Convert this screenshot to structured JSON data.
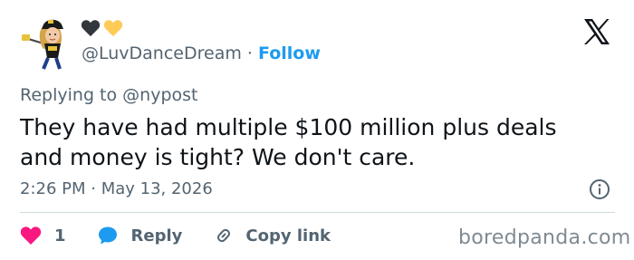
{
  "author": {
    "handle": "@LuvDanceDream",
    "separator": "·",
    "follow_label": "Follow",
    "display_name_emoji": [
      "black-heart",
      "yellow-heart"
    ]
  },
  "replying_to": "Replying to @nypost",
  "tweet": {
    "lines": [
      "They have had multiple $100 million plus deals",
      "and money is tight? We don't care."
    ],
    "timestamp": "2:26 PM · May 13, 2026"
  },
  "actions": {
    "like_count": "1",
    "reply_label": "Reply",
    "copy_link_label": "Copy link"
  },
  "watermark": "boredpanda.com",
  "colors": {
    "text": "#0f1419",
    "secondary": "#536471",
    "accent": "#1d9bf0",
    "like": "#f91880"
  },
  "icons": [
    "x-logo",
    "info-icon",
    "heart-icon",
    "reply-bubble-icon",
    "link-icon"
  ]
}
